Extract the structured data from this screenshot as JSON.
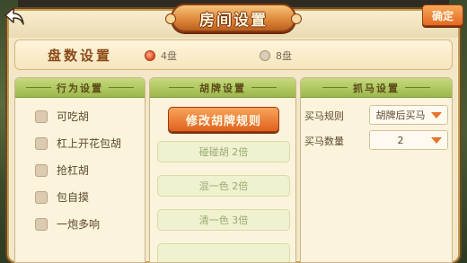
{
  "header": {
    "title": "房间设置",
    "confirm_label": "确定"
  },
  "rounds": {
    "label": "盘数设置",
    "options": [
      {
        "label": "4盘",
        "selected": true
      },
      {
        "label": "8盘",
        "selected": false
      }
    ]
  },
  "rules_panel": {
    "title": "行为设置",
    "items": [
      "可吃胡",
      "杠上开花包胡",
      "抢杠胡",
      "包自摸",
      "一炮多响"
    ]
  },
  "hu_panel": {
    "title": "胡牌设置",
    "modify_label": "修改胡牌规则",
    "items": [
      "碰碰胡 2倍",
      "混一色 2倍",
      "清一色 3倍"
    ]
  },
  "horse_panel": {
    "title": "抓马设置",
    "rule_label": "买马规则",
    "rule_value": "胡牌后买马",
    "count_label": "买马数量",
    "count_value": "2"
  },
  "colors": {
    "accent_orange": "#e26a24",
    "panel_green": "#9cb84c",
    "selected_radio": "#e8542a"
  },
  "icons": {
    "back": "back-arrow-icon",
    "dropdown": "dropdown-triangle-icon"
  }
}
